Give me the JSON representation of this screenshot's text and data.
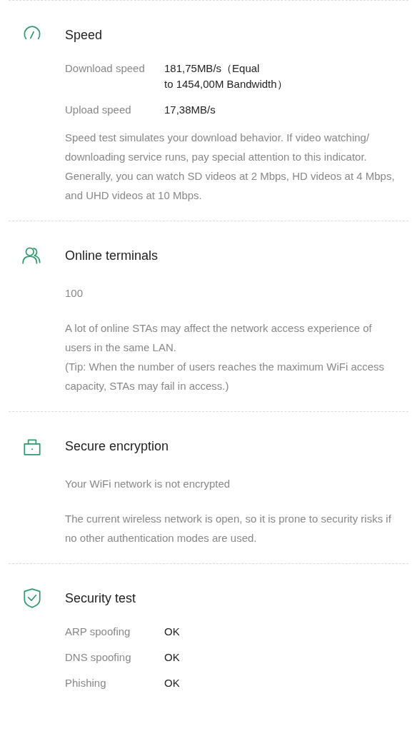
{
  "sections": [
    {
      "kind": "speed",
      "title": "Speed",
      "blocks": [
        {
          "kind": "row",
          "label": "Download speed",
          "value": "181,75MB/s（Equal\nto 1454,00M Bandwidth）"
        },
        {
          "kind": "row",
          "label": "Upload speed",
          "value": "17,38MB/s"
        },
        {
          "kind": "note",
          "text": "Speed test simulates your download behavior. If video watching/ downloading service runs, pay special attention to this indicator. Generally, you can watch SD videos at 2 Mbps, HD videos at 4 Mbps, and UHD videos at 10 Mbps."
        }
      ]
    },
    {
      "kind": "users",
      "title": "Online terminals",
      "blocks": [
        {
          "kind": "text",
          "text": "100"
        },
        {
          "kind": "note",
          "text": "A lot of online STAs may affect the network access experience of users in the same LAN.\n(Tip: When the number of users reaches the maximum WiFi access capacity, STAs may fail in access.)"
        }
      ]
    },
    {
      "kind": "lock",
      "title": "Secure encryption",
      "blocks": [
        {
          "kind": "text",
          "text": "Your WiFi network is not encrypted"
        },
        {
          "kind": "note",
          "text": "The current wireless network is open, so it is prone to security risks if no other authentication modes are used."
        }
      ]
    },
    {
      "kind": "shield",
      "title": "Security test",
      "blocks": [
        {
          "kind": "row",
          "label": "ARP spoofing",
          "value": "OK"
        },
        {
          "kind": "row",
          "label": "DNS spoofing",
          "value": "OK"
        },
        {
          "kind": "row",
          "label": "Phishing",
          "value": "OK"
        }
      ]
    }
  ]
}
